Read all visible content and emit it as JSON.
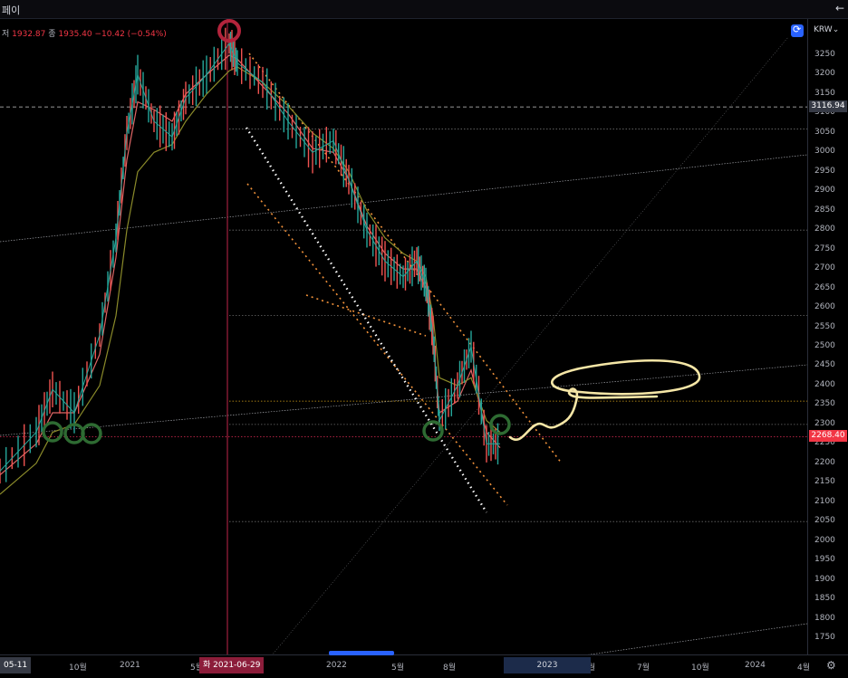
{
  "header": {
    "title": "페이",
    "back_icon": "arrow-left-icon"
  },
  "ohlc": {
    "low_label": "저",
    "low_value": "1932.87",
    "close_label": "종",
    "close_value": "1935.40",
    "change": "−10.42 (−0.54%)"
  },
  "toolbar": {
    "currency": "KRW",
    "currency_icon": "chevron-down-icon",
    "sync_icon": "sync-icon",
    "settings_icon": "gear-icon"
  },
  "price_badges": {
    "last_high": "3116.94",
    "current": "2268.40",
    "current_color": "#f23645",
    "neutral_color": "#363a45"
  },
  "crosshair": {
    "date_label": "화 2021-06-29",
    "date_color": "#8c1d3a"
  },
  "range_labels": {
    "start": "05-11",
    "period": "2023"
  },
  "chart_data": {
    "type": "line",
    "title": "",
    "xlabel": "",
    "ylabel": "",
    "y_range": [
      1740,
      3300
    ],
    "y_ticks": [
      3250,
      3200,
      3150,
      3100,
      3050,
      3000,
      2950,
      2900,
      2850,
      2800,
      2750,
      2700,
      2650,
      2600,
      2550,
      2500,
      2450,
      2400,
      2350,
      2300,
      2250,
      2200,
      2150,
      2100,
      2050,
      2000,
      1950,
      1900,
      1850,
      1800,
      1750
    ],
    "x_ticks": [
      "10월",
      "2021",
      "5월",
      "2022",
      "5월",
      "8월",
      "2023",
      "4월",
      "7월",
      "10월",
      "2024",
      "4월"
    ],
    "grid": false,
    "series": [
      {
        "color": "#26a69a",
        "x": [
          "2020-06",
          "2020-08",
          "2020-09",
          "2020-10",
          "2020-11",
          "2020-12",
          "2021-01",
          "2021-01",
          "2021-02",
          "2021-03",
          "2021-04",
          "2021-05",
          "2021-06",
          "2021-06",
          "2021-07",
          "2021-08",
          "2021-09",
          "2021-10",
          "2021-11",
          "2021-12",
          "2022-01",
          "2022-02",
          "2022-03",
          "2022-04",
          "2022-05",
          "2022-06",
          "2022-07",
          "2022-08",
          "2022-09",
          "2022-10"
        ],
        "values": [
          2180,
          2280,
          2390,
          2330,
          2530,
          2780,
          3050,
          3200,
          3080,
          3040,
          3140,
          3200,
          3280,
          3230,
          3180,
          3080,
          3000,
          3030,
          2930,
          2800,
          2720,
          2680,
          2720,
          2660,
          2530,
          2310,
          2400,
          2500,
          2250,
          2250
        ]
      }
    ],
    "moving_averages": [
      {
        "color": "#e06666",
        "values": [
          2170,
          2250,
          2330,
          2330,
          2480,
          2730,
          2980,
          3130,
          3110,
          3080,
          3150,
          3200,
          3250,
          3240,
          3170,
          3100,
          3010,
          3000,
          2930,
          2810,
          2740,
          2700,
          2700,
          2650,
          2520,
          2330,
          2360,
          2440,
          2280,
          2240
        ]
      },
      {
        "color": "#8b8b2a",
        "values": [
          2120,
          2200,
          2280,
          2300,
          2400,
          2580,
          2800,
          2950,
          3000,
          3020,
          3080,
          3150,
          3210,
          3220,
          3180,
          3120,
          3050,
          3010,
          2950,
          2850,
          2780,
          2740,
          2720,
          2680,
          2580,
          2420,
          2400,
          2420,
          2310,
          2280
        ]
      }
    ],
    "horizontal_levels": [
      3116.94,
      3060,
      2800,
      2580,
      2360,
      2300,
      2268.4,
      2050
    ],
    "annotations": [
      "2021-06-29"
    ]
  }
}
